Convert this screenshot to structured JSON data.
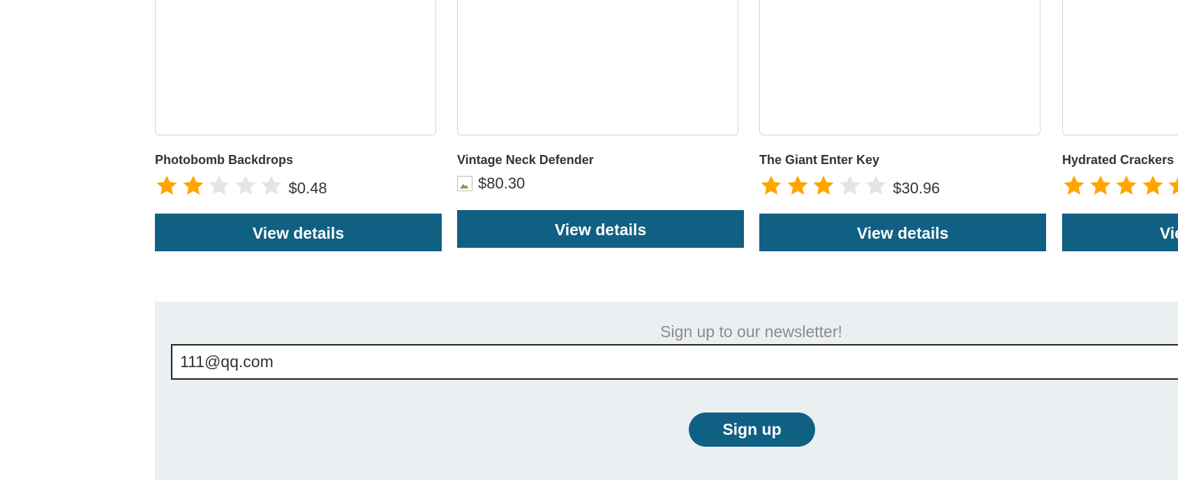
{
  "products": [
    {
      "name": "Photobomb Backdrops",
      "rating": 2,
      "rating_max": 5,
      "price": "$0.48",
      "button_label": "View details"
    },
    {
      "name": "Vintage Neck Defender",
      "rating_image": "broken-image-icon",
      "price": "$80.30",
      "button_label": "View details"
    },
    {
      "name": "The Giant Enter Key",
      "rating": 3,
      "rating_max": 5,
      "price": "$30.96",
      "button_label": "View details"
    },
    {
      "name": "Hydrated Crackers",
      "rating": 5,
      "rating_max": 5,
      "price": "",
      "button_label": "View details"
    }
  ],
  "newsletter": {
    "heading": "Sign up to our newsletter!",
    "email_value": "111@qq.com",
    "signup_label": "Sign up"
  },
  "colors": {
    "accent": "#106084",
    "star_filled": "#FFA500",
    "star_empty": "#E1E5E8",
    "newsletter_bg": "#EAEFF2"
  }
}
